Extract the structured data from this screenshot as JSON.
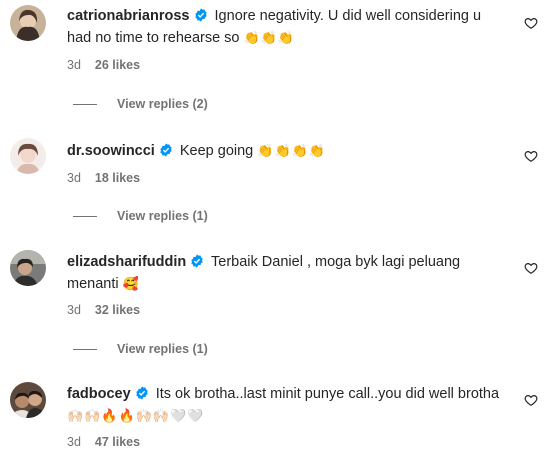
{
  "comments": [
    {
      "username": "catrionabrianross",
      "verified": true,
      "text": "Ignore negativity. U did well considering u had no time to rehearse so",
      "emoji": "👏👏👏",
      "time": "3d",
      "likes": "26 likes",
      "replies": "View replies (2)",
      "avatar_color": "#a08a72"
    },
    {
      "username": "dr.soowincci",
      "verified": true,
      "text": "Keep going",
      "emoji": "👏👏👏👏",
      "time": "3d",
      "likes": "18 likes",
      "replies": "View replies (1)",
      "avatar_color": "#e8c9c0"
    },
    {
      "username": "elizadsharifuddin",
      "verified": true,
      "text": "Terbaik Daniel , moga byk lagi peluang menanti",
      "emoji": "🥰",
      "time": "3d",
      "likes": "32 likes",
      "replies": "View replies (1)",
      "avatar_color": "#5a5a5a"
    },
    {
      "username": "fadbocey",
      "verified": true,
      "text": "Its ok brotha..last minit punye call..you did well brotha",
      "emoji": "🙌🏻🙌🏻🔥🔥🙌🏻🙌🏻🤍🤍",
      "time": "3d",
      "likes": "47 likes",
      "avatar_color": "#8a6b55"
    }
  ],
  "colors": {
    "verified_blue": "#0095f6",
    "meta_gray": "#737373",
    "text_dark": "#262626"
  },
  "icons": {
    "verified": "verified-badge-icon",
    "like": "heart-outline-icon"
  }
}
